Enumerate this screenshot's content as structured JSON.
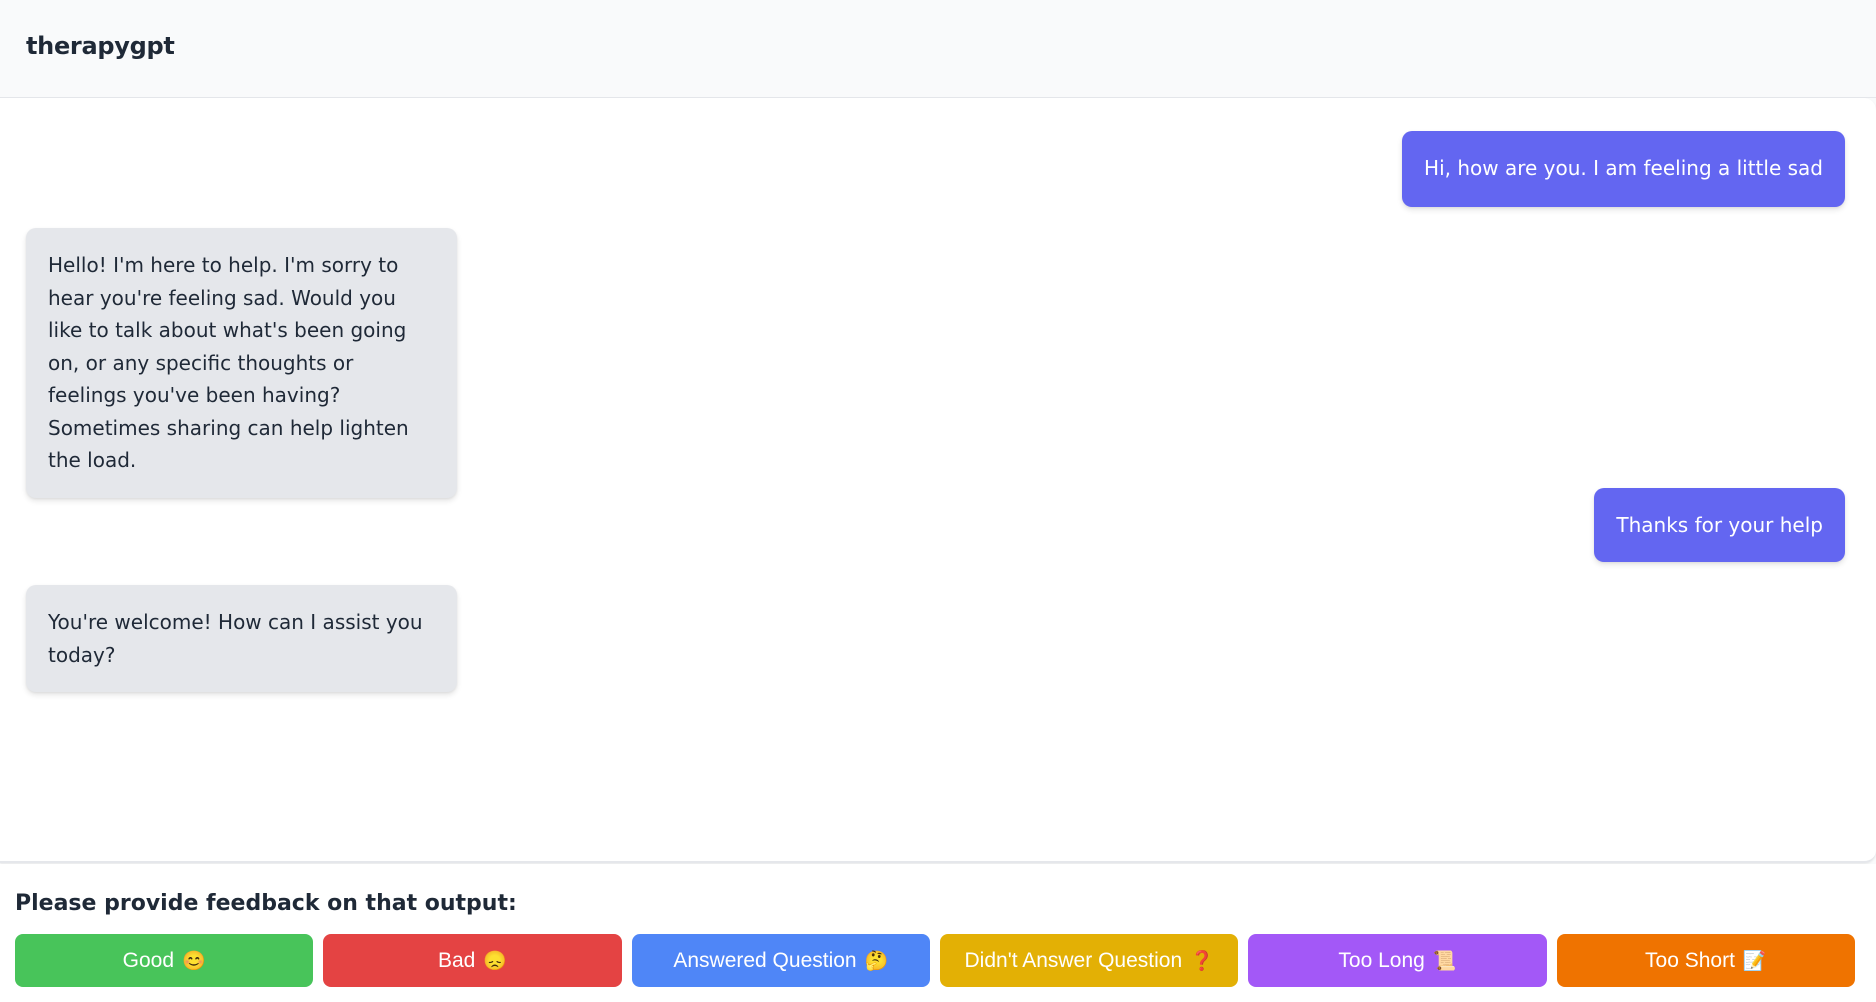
{
  "header": {
    "title": "therapygpt"
  },
  "chat": {
    "messages": [
      {
        "role": "user",
        "text": "Hi, how are you. I am feeling a little sad"
      },
      {
        "role": "assistant",
        "text": "Hello! I'm here to help. I'm sorry to hear you're feeling sad. Would you like to talk about what's been going on, or any specific thoughts or feelings you've been having? Sometimes sharing can help lighten the load."
      },
      {
        "role": "user",
        "text": "Thanks for your help"
      },
      {
        "role": "assistant",
        "text": "You're welcome! How can I assist you today?"
      }
    ],
    "colors": {
      "user_bubble": "#6366f1",
      "assistant_bubble": "#e5e7eb"
    }
  },
  "feedback": {
    "prompt": "Please provide feedback on that output:",
    "buttons": [
      {
        "label": "Good",
        "emoji": "😊",
        "icon": "smiling-face-icon",
        "color": "#48c45a"
      },
      {
        "label": "Bad",
        "emoji": "😞",
        "icon": "disappointed-face-icon",
        "color": "#e44343"
      },
      {
        "label": "Answered Question",
        "emoji": "🤔",
        "icon": "thinking-face-icon",
        "color": "#4f86f7"
      },
      {
        "label": "Didn't Answer Question",
        "emoji": "❓",
        "icon": "question-mark-icon",
        "color": "#e3b005"
      },
      {
        "label": "Too Long",
        "emoji": "📜",
        "icon": "scroll-icon",
        "color": "#a358f7"
      },
      {
        "label": "Too Short",
        "emoji": "📝",
        "icon": "memo-icon",
        "color": "#ef7300"
      }
    ]
  }
}
